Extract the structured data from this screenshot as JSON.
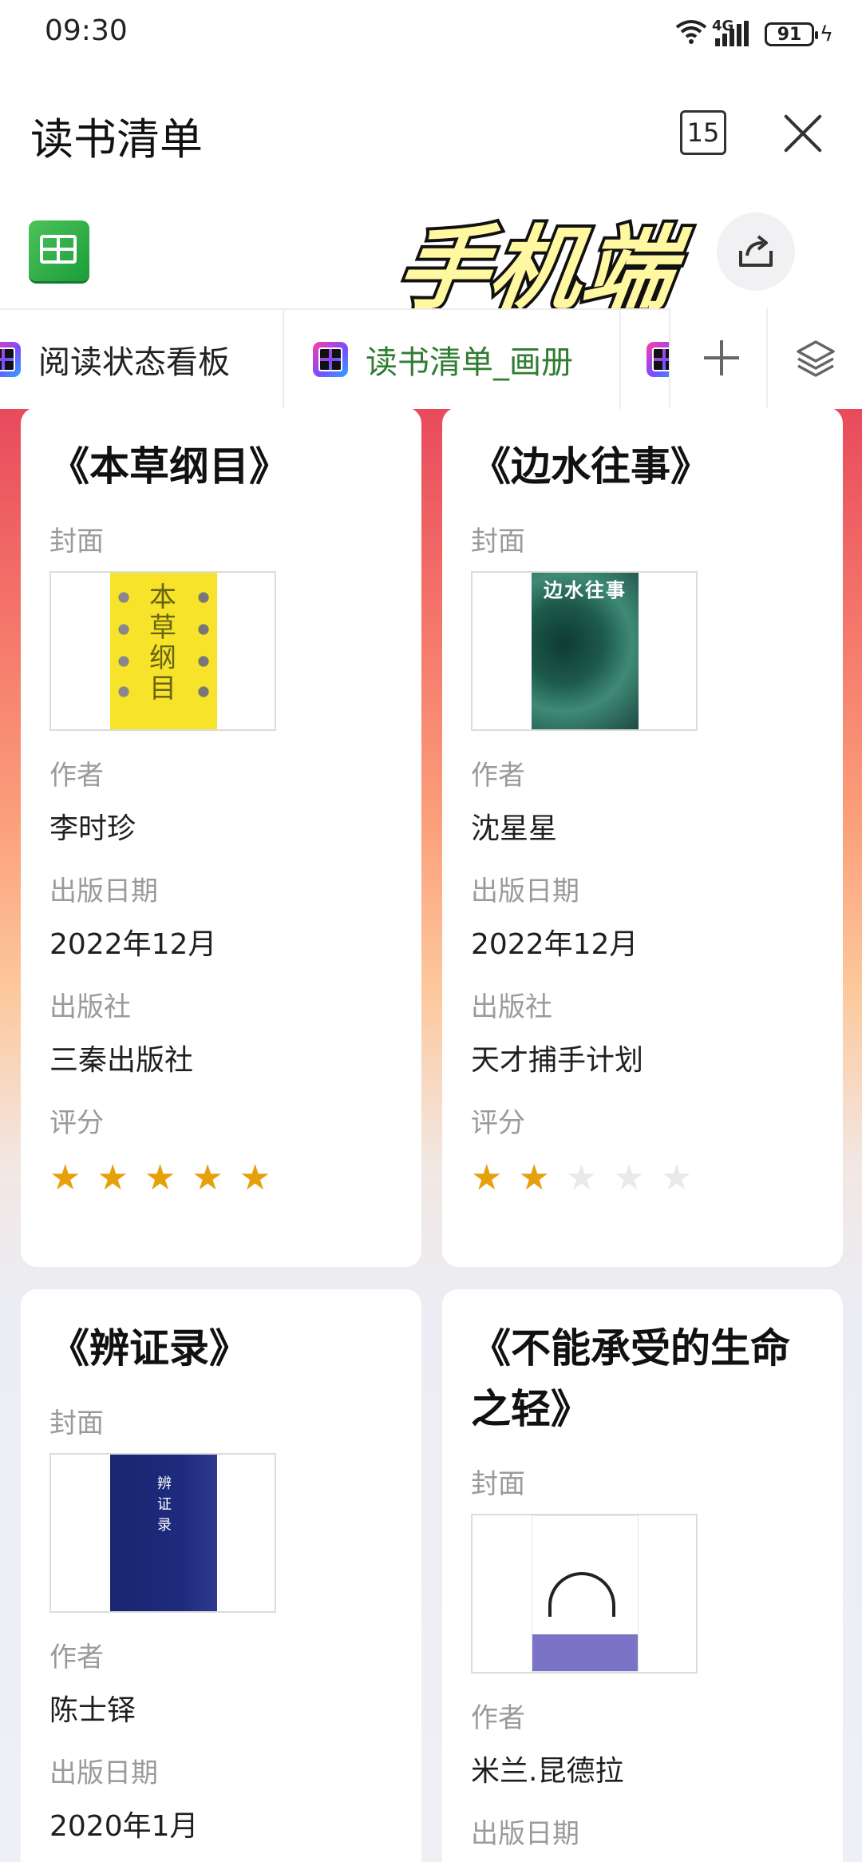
{
  "status_bar": {
    "time": "09:30",
    "network": "4G",
    "battery": "91"
  },
  "title_bar": {
    "title": "读书清单",
    "tab_count": "15"
  },
  "overlay": {
    "text": "手机端"
  },
  "tabs": [
    {
      "label": "阅读状态看板",
      "active": false
    },
    {
      "label": "读书清单_画册",
      "active": true
    }
  ],
  "cards": [
    {
      "title": "《本草纲目》",
      "cover_label": "封面",
      "cover_text": "本草纲目",
      "author_label": "作者",
      "author": "李时珍",
      "date_label": "出版日期",
      "date": "2022年12月",
      "publisher_label": "出版社",
      "publisher": "三秦出版社",
      "rating_label": "评分",
      "rating": 5,
      "rating_max": 5
    },
    {
      "title": "《边水往事》",
      "cover_label": "封面",
      "cover_text": "边水往事",
      "author_label": "作者",
      "author": "沈星星",
      "date_label": "出版日期",
      "date": "2022年12月",
      "publisher_label": "出版社",
      "publisher": "天才捕手计划",
      "rating_label": "评分",
      "rating": 2,
      "rating_max": 5
    },
    {
      "title": "《辨证录》",
      "cover_label": "封面",
      "cover_text": "辨证录",
      "author_label": "作者",
      "author": "陈士铎",
      "date_label": "出版日期",
      "date": "2020年1月"
    },
    {
      "title": "《不能承受的生命之轻》",
      "cover_label": "封面",
      "author_label": "作者",
      "author": "米兰.昆德拉",
      "date_label": "出版日期"
    }
  ],
  "colors": {
    "accent_green": "#2f7d32",
    "star_on": "#e6a00c",
    "star_off": "#e9e9ec"
  }
}
